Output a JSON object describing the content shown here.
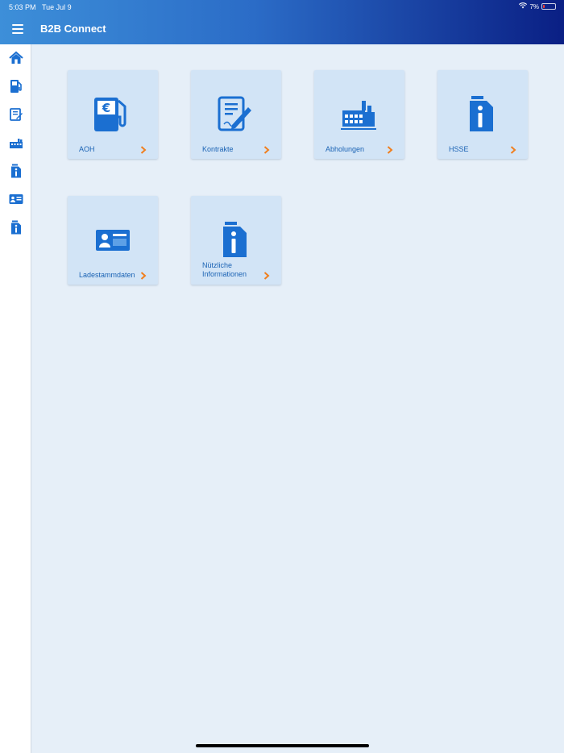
{
  "status_bar": {
    "time": "5:03 PM",
    "date": "Tue Jul 9",
    "battery": "7%"
  },
  "header": {
    "title": "B2B Connect"
  },
  "colors": {
    "accent": "#1b63b4",
    "chevron": "#f07f1e",
    "tile_bg": "#d2e4f6"
  },
  "sidebar": {
    "items": [
      {
        "icon": "home-icon"
      },
      {
        "icon": "fuel-pump-icon"
      },
      {
        "icon": "contract-icon"
      },
      {
        "icon": "factory-icon"
      },
      {
        "icon": "info-canister-icon"
      },
      {
        "icon": "id-card-icon"
      },
      {
        "icon": "info-canister-icon"
      }
    ]
  },
  "tiles": [
    {
      "label": "AOH",
      "icon": "fuel-pump-euro-icon"
    },
    {
      "label": "Kontrakte",
      "icon": "contract-icon"
    },
    {
      "label": "Abholungen",
      "icon": "factory-icon"
    },
    {
      "label": "HSSE",
      "icon": "info-canister-icon"
    },
    {
      "label": "Ladestammdaten",
      "icon": "id-card-icon"
    },
    {
      "label_line1": "Nützliche",
      "label_line2": "Informationen",
      "icon": "info-canister-icon"
    }
  ]
}
